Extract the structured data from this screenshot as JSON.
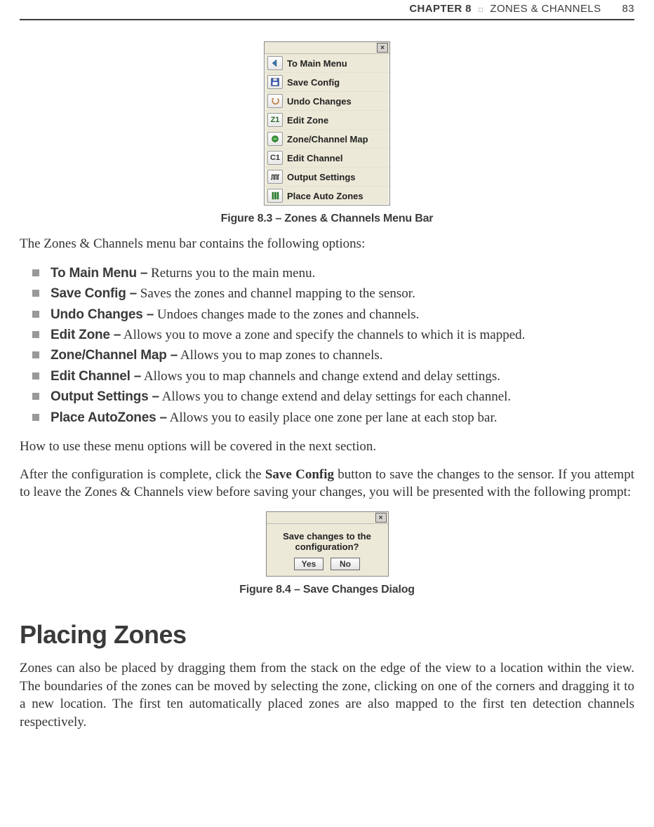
{
  "header": {
    "chapter_label": "CHAPTER 8",
    "separator": "□",
    "chapter_title": "ZONES & CHANNELS",
    "page_number": "83"
  },
  "figure_menu": {
    "items": [
      {
        "icon": "back-arrow-icon",
        "label": "To Main Menu"
      },
      {
        "icon": "save-icon",
        "label": "Save Config"
      },
      {
        "icon": "undo-icon",
        "label": "Undo Changes"
      },
      {
        "icon": "z1-icon",
        "glyph": "Z1",
        "label": "Edit Zone"
      },
      {
        "icon": "map-icon",
        "label": "Zone/Channel Map"
      },
      {
        "icon": "c1-icon",
        "glyph": "C1",
        "label": "Edit Channel"
      },
      {
        "icon": "waveform-icon",
        "label": "Output Settings"
      },
      {
        "icon": "auto-zones-icon",
        "label": "Place Auto Zones"
      }
    ],
    "caption": "Figure 8.3 – Zones & Channels Menu Bar"
  },
  "intro_para": "The Zones & Channels menu bar contains the following options:",
  "options": [
    {
      "label": "To Main Menu –",
      "desc": " Returns you to the main menu."
    },
    {
      "label": "Save Config –",
      "desc": " Saves the zones and channel mapping to the sensor."
    },
    {
      "label": "Undo Changes –",
      "desc": " Undoes changes made to the zones and channels."
    },
    {
      "label": "Edit Zone –",
      "desc": " Allows you to move a zone and specify the channels to which it is mapped."
    },
    {
      "label": "Zone/Channel Map –",
      "desc": " Allows you to map zones to channels."
    },
    {
      "label": "Edit Channel –",
      "desc": " Allows you to map channels and change extend and delay settings."
    },
    {
      "label": "Output Settings –",
      "desc": " Allows you to change extend and delay settings for each channel."
    },
    {
      "label": "Place AutoZones –",
      "desc": " Allows you to easily place one zone per lane at each stop bar."
    }
  ],
  "para_after_list": "How to use these menu options will be covered in the next section.",
  "para_save": {
    "before": "After the configuration is complete, click the ",
    "bold": "Save Config",
    "after": " button to save the changes to the sensor. If you attempt to leave the Zones & Channels view before saving your changes, you will be presented with the following prompt:"
  },
  "dialog": {
    "message": "Save changes to the configuration?",
    "yes": "Yes",
    "no": "No",
    "caption": "Figure 8.4 – Save Changes Dialog"
  },
  "section": {
    "title": "Placing Zones",
    "body": "Zones can also be placed by dragging them from the stack on the edge of the view to a location within the view. The boundaries of the zones can be moved by selecting the zone, clicking on one of the corners and dragging it to a new location. The first ten automatically placed zones are also mapped to the first ten detection channels respectively."
  }
}
